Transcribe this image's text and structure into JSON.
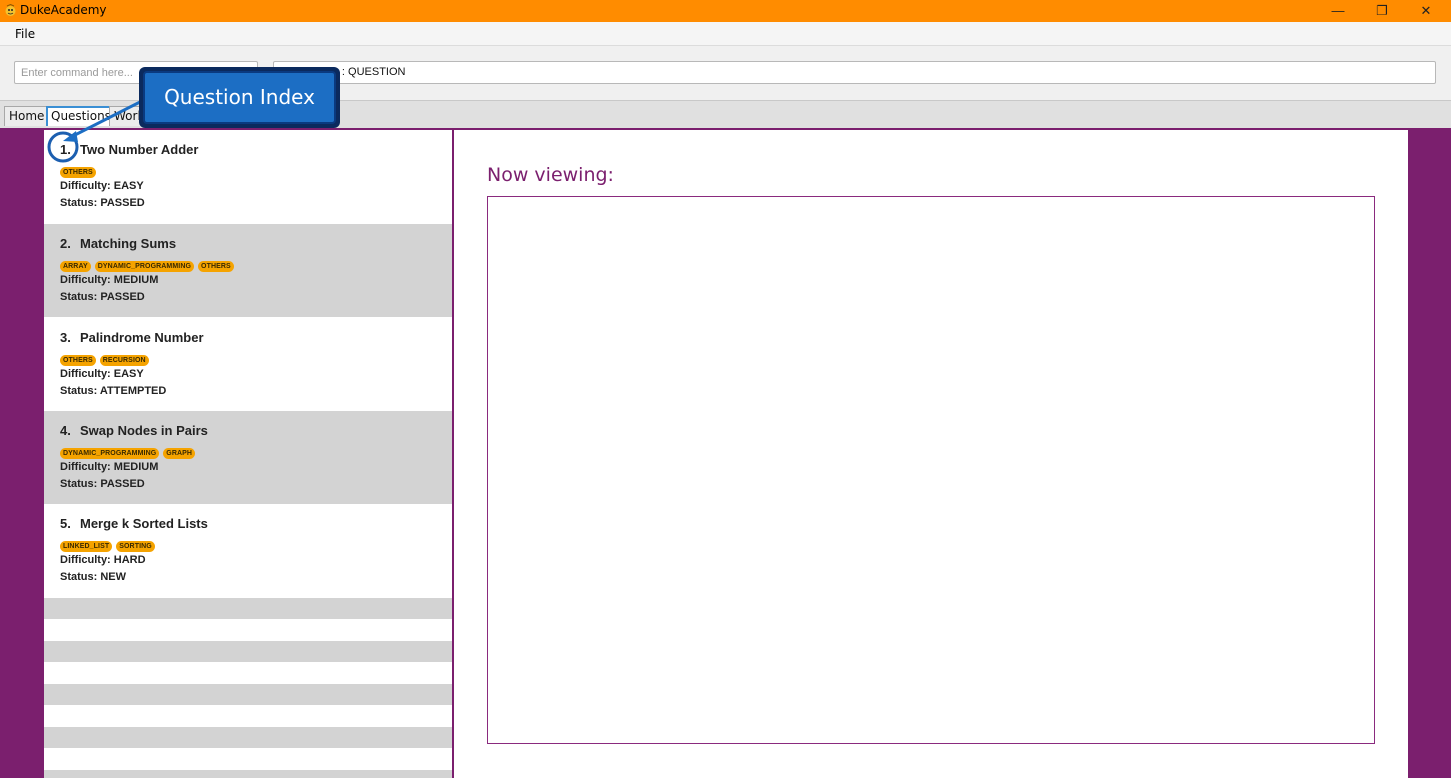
{
  "window": {
    "title": "DukeAcademy",
    "minimize": "—",
    "maximize": "❐",
    "close": "✕"
  },
  "menu": {
    "file": "File"
  },
  "command": {
    "placeholder": "Enter command here...",
    "result": "Switched to : QUESTION"
  },
  "tabs": [
    {
      "label": "Home",
      "active": false
    },
    {
      "label": "Questions",
      "active": true
    },
    {
      "label": "Workspace",
      "active": false
    }
  ],
  "questions": [
    {
      "index": "1.",
      "title": "Two Number Adder",
      "tags": [
        "OTHERS"
      ],
      "difficulty": "Difficulty: EASY",
      "status": "Status: PASSED"
    },
    {
      "index": "2.",
      "title": "Matching Sums",
      "tags": [
        "ARRAY",
        "DYNAMIC_PROGRAMMING",
        "OTHERS"
      ],
      "difficulty": "Difficulty: MEDIUM",
      "status": "Status: PASSED"
    },
    {
      "index": "3.",
      "title": "Palindrome Number",
      "tags": [
        "OTHERS",
        "RECURSION"
      ],
      "difficulty": "Difficulty: EASY",
      "status": "Status: ATTEMPTED"
    },
    {
      "index": "4.",
      "title": "Swap Nodes in Pairs",
      "tags": [
        "DYNAMIC_PROGRAMMING",
        "GRAPH"
      ],
      "difficulty": "Difficulty: MEDIUM",
      "status": "Status: PASSED"
    },
    {
      "index": "5.",
      "title": "Merge k Sorted Lists",
      "tags": [
        "LINKED_LIST",
        "SORTING"
      ],
      "difficulty": "Difficulty: HARD",
      "status": "Status: NEW"
    }
  ],
  "viewer": {
    "label": "Now viewing:"
  },
  "annotation": {
    "label": "Question Index"
  },
  "colors": {
    "titlebar": "#ff8c00",
    "accent": "#7b1f6e",
    "tag": "#f5a300",
    "callout": "#1c6ec4"
  },
  "icons": {
    "app": "duke-app-icon"
  }
}
